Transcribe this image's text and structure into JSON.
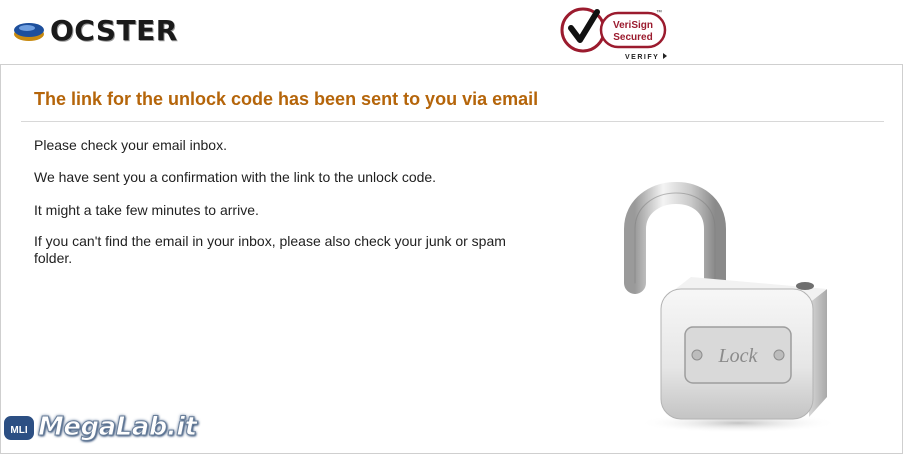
{
  "header": {
    "logo_text": "OCSTER",
    "seal": {
      "line1": "VeriSign",
      "line2": "Secured",
      "verify": "VERIFY",
      "tm": "™"
    }
  },
  "main": {
    "title": "The link for the unlock code has been sent to you via email",
    "messages": [
      "Please check your email inbox.",
      "We have sent you a confirmation with the link to the unlock code.",
      "It might a take few minutes to arrive.",
      "If you can't find the email in your inbox, please also check your junk or spam folder."
    ],
    "lock_label": "Lock"
  },
  "watermark": {
    "text": "MegaLab.it",
    "badge": "MLI"
  },
  "colors": {
    "title": "#b5650a",
    "seal_red": "#9b1b2e",
    "text": "#1f1f1f"
  },
  "icons": [
    "ocster-logo-icon",
    "verisign-checkmark-icon",
    "open-padlock-icon"
  ]
}
